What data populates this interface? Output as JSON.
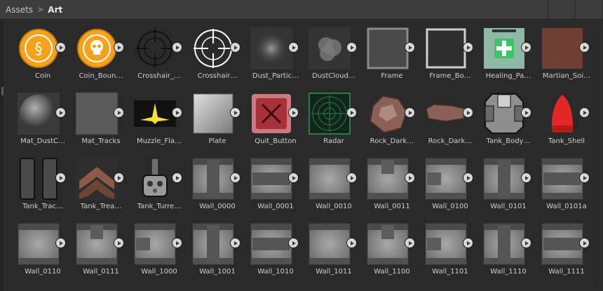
{
  "breadcrumb": {
    "root": "Assets",
    "separator": ">",
    "current": "Art"
  },
  "assets": [
    {
      "label": "Coin",
      "icon": "coin-dollar-icon",
      "color": "#f7a21b"
    },
    {
      "label": "Coin_Boun…",
      "icon": "coin-skull-icon",
      "color": "#f7a21b"
    },
    {
      "label": "Crosshair_…",
      "icon": "crosshair-dark-icon",
      "color": "#111111"
    },
    {
      "label": "Crosshair…",
      "icon": "crosshair-white-icon",
      "color": "#ffffff"
    },
    {
      "label": "Dust_Partic…",
      "icon": "dust-particle-icon",
      "color": "#8a8a8a"
    },
    {
      "label": "DustCloud…",
      "icon": "dust-cloud-icon",
      "color": "#7a7a7a"
    },
    {
      "label": "Frame",
      "icon": "frame-icon",
      "color": "#8a8a8a"
    },
    {
      "label": "Frame_Bo…",
      "icon": "frame-border-icon",
      "color": "#cfcfcf"
    },
    {
      "label": "Healing_Pa…",
      "icon": "healing-pad-icon",
      "color": "#3cc46b"
    },
    {
      "label": "Martian_Soi…",
      "icon": "martian-soil-icon",
      "color": "#6e3f32"
    },
    {
      "label": "Mat_DustC…",
      "icon": "material-sphere-icon",
      "color": "#7c7c7c"
    },
    {
      "label": "Mat_Tracks",
      "icon": "material-flat-icon",
      "color": "#5a5a5a"
    },
    {
      "label": "Muzzle_Fla…",
      "icon": "muzzle-flash-icon",
      "color": "#f4e23a"
    },
    {
      "label": "Plate",
      "icon": "plate-icon",
      "color": "#b4b4b4"
    },
    {
      "label": "Quit_Button",
      "icon": "quit-button-icon",
      "color": "#a8313a"
    },
    {
      "label": "Radar",
      "icon": "radar-icon",
      "color": "#2f7a4a"
    },
    {
      "label": "Rock_Dark…",
      "icon": "rock-large-icon",
      "color": "#8a6154"
    },
    {
      "label": "Rock_Dark…",
      "icon": "rock-flat-icon",
      "color": "#8a6154"
    },
    {
      "label": "Tank_Body…",
      "icon": "tank-body-icon",
      "color": "#8e8e8e"
    },
    {
      "label": "Tank_Shell",
      "icon": "tank-shell-icon",
      "color": "#e52626"
    },
    {
      "label": "Tank_Trac…",
      "icon": "tank-tracks-icon",
      "color": "#4a4a4a"
    },
    {
      "label": "Tank_Trea…",
      "icon": "tank-tread-icon",
      "color": "#8c5a45"
    },
    {
      "label": "Tank_Turre…",
      "icon": "tank-turret-icon",
      "color": "#9a9a9a"
    },
    {
      "label": "Wall_0000",
      "icon": "wall-tile-icon",
      "color": "#8c8c8c"
    },
    {
      "label": "Wall_0001",
      "icon": "wall-tile-icon",
      "color": "#8c8c8c"
    },
    {
      "label": "Wall_0010",
      "icon": "wall-tile-icon",
      "color": "#8c8c8c"
    },
    {
      "label": "Wall_0011",
      "icon": "wall-tile-icon",
      "color": "#8c8c8c"
    },
    {
      "label": "Wall_0100",
      "icon": "wall-tile-icon",
      "color": "#8c8c8c"
    },
    {
      "label": "Wall_0101",
      "icon": "wall-tile-icon",
      "color": "#8c8c8c"
    },
    {
      "label": "Wall_0101a",
      "icon": "wall-tile-icon",
      "color": "#8c8c8c"
    },
    {
      "label": "Wall_0110",
      "icon": "wall-tile-icon",
      "color": "#8c8c8c"
    },
    {
      "label": "Wall_0111",
      "icon": "wall-tile-icon",
      "color": "#8c8c8c"
    },
    {
      "label": "Wall_1000",
      "icon": "wall-tile-icon",
      "color": "#8c8c8c"
    },
    {
      "label": "Wall_1001",
      "icon": "wall-tile-icon",
      "color": "#8c8c8c"
    },
    {
      "label": "Wall_1010",
      "icon": "wall-tile-icon",
      "color": "#8c8c8c"
    },
    {
      "label": "Wall_1011",
      "icon": "wall-tile-icon",
      "color": "#8c8c8c"
    },
    {
      "label": "Wall_1100",
      "icon": "wall-tile-icon",
      "color": "#8c8c8c"
    },
    {
      "label": "Wall_1101",
      "icon": "wall-tile-icon",
      "color": "#8c8c8c"
    },
    {
      "label": "Wall_1110",
      "icon": "wall-tile-icon",
      "color": "#8c8c8c"
    },
    {
      "label": "Wall_1111",
      "icon": "wall-tile-icon",
      "color": "#8c8c8c"
    }
  ],
  "colors": {
    "background": "#2a2a2a",
    "breadcrumb_bar": "#3c3c3c",
    "label_text": "#cfcfcf",
    "play_badge": "#d8d8d8"
  }
}
